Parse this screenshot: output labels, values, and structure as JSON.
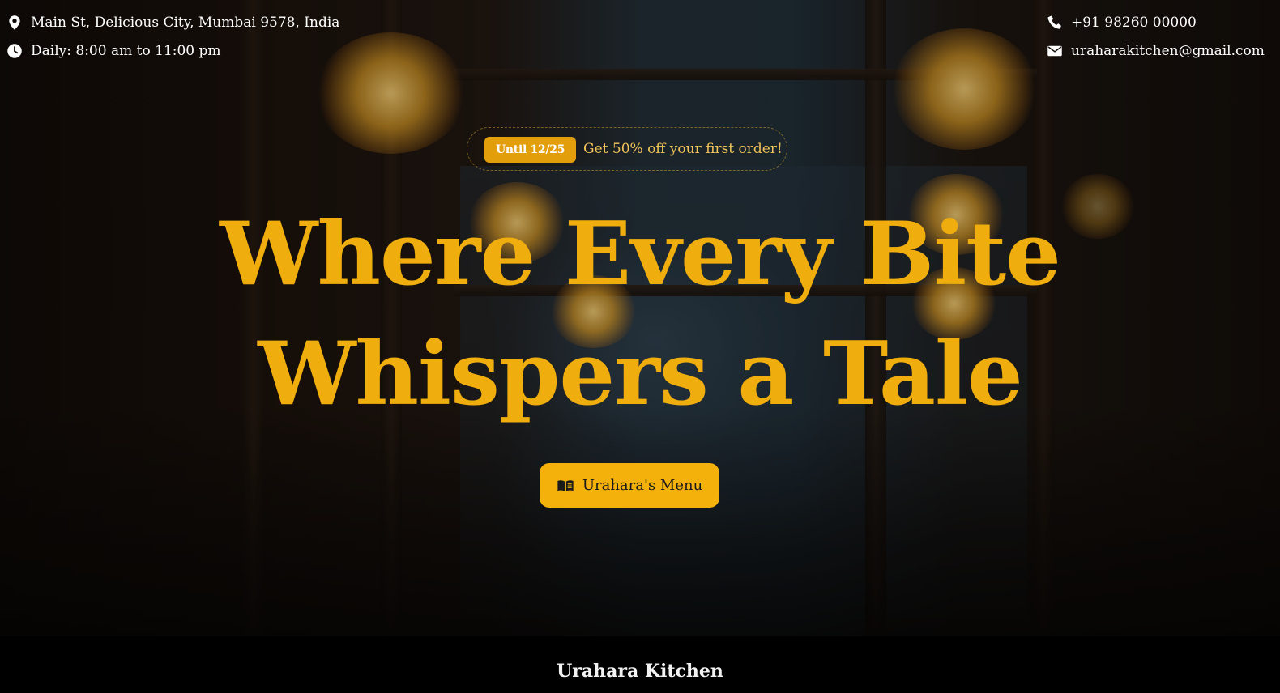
{
  "contact": {
    "address": "Main St, Delicious City, Mumbai 9578, India",
    "hours": "Daily: 8:00 am to 11:00 pm",
    "phone": "+91 98260 00000",
    "email": "uraharakitchen@gmail.com",
    "icons": {
      "address": "location-pin-icon",
      "hours": "clock-icon",
      "phone": "phone-icon",
      "email": "envelope-icon"
    }
  },
  "promo": {
    "tag": "Until 12/25",
    "text": "Get 50% off your first order!"
  },
  "hero": {
    "headline_line1": "Where Every Bite",
    "headline_line2": "Whispers a Tale",
    "menu_button_label": "Urahara's Menu",
    "menu_button_icon": "book-open-icon"
  },
  "footer": {
    "brand": "Urahara Kitchen"
  },
  "colors": {
    "accent": "#f0ad0e",
    "button": "#f4b10c",
    "tag": "#e39e0c",
    "promo_text": "#f2c35a",
    "footer_bg": "#000000"
  }
}
